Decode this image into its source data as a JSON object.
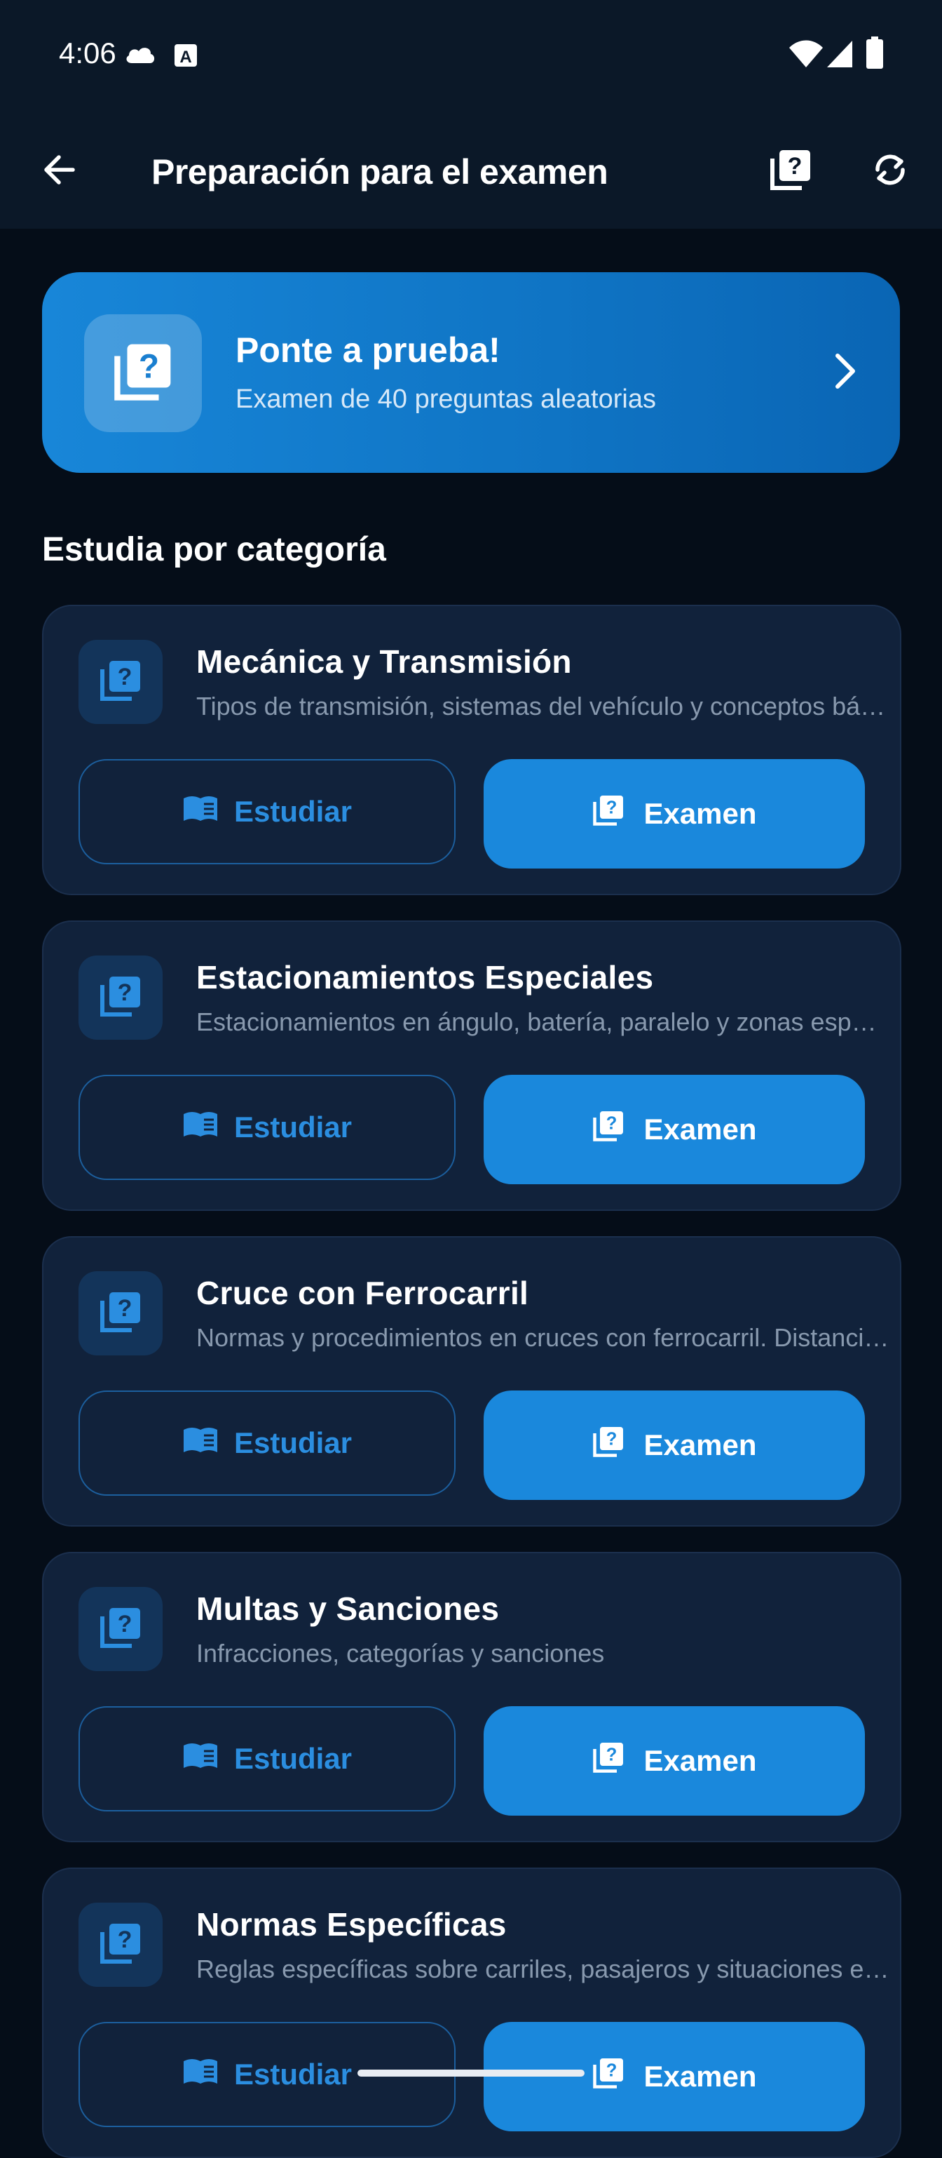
{
  "status_bar": {
    "time": "4:06",
    "left_icons": [
      "cloud-icon",
      "app-a-icon"
    ],
    "right_icons": [
      "wifi-icon",
      "signal-icon",
      "battery-icon"
    ]
  },
  "app_bar": {
    "title": "Preparación para el examen",
    "back_icon": "arrow-left-icon",
    "actions": [
      "quiz-icon",
      "sync-icon"
    ]
  },
  "hero": {
    "title": "Ponte a prueba!",
    "subtitle": "Examen de 40 preguntas aleatorias",
    "icon": "quiz-icon",
    "chevron": "chevron-right-icon"
  },
  "section_title": "Estudia por categoría",
  "buttons": {
    "study_label": "Estudiar",
    "exam_label": "Examen",
    "study_icon": "book-icon",
    "exam_icon": "quiz-icon"
  },
  "categories": [
    {
      "title": "Mecánica y Transmisión",
      "description": "Tipos de transmisión, sistemas del vehículo y conceptos básicos de mecánica"
    },
    {
      "title": "Estacionamientos Especiales",
      "description": "Estacionamientos en ángulo, batería, paralelo y zonas especiales"
    },
    {
      "title": "Cruce con Ferrocarril",
      "description": "Normas y procedimientos en cruces con ferrocarril. Distancias y señales"
    },
    {
      "title": "Multas y Sanciones",
      "description": "Infracciones, categorías y sanciones"
    },
    {
      "title": "Normas Específicas",
      "description": "Reglas específicas sobre carriles, pasajeros y situaciones especiales"
    }
  ],
  "colors": {
    "background": "#050d18",
    "app_bar": "#0b1828",
    "card": "#11223b",
    "accent": "#1a88dc",
    "study_text": "#2b8ee0"
  }
}
